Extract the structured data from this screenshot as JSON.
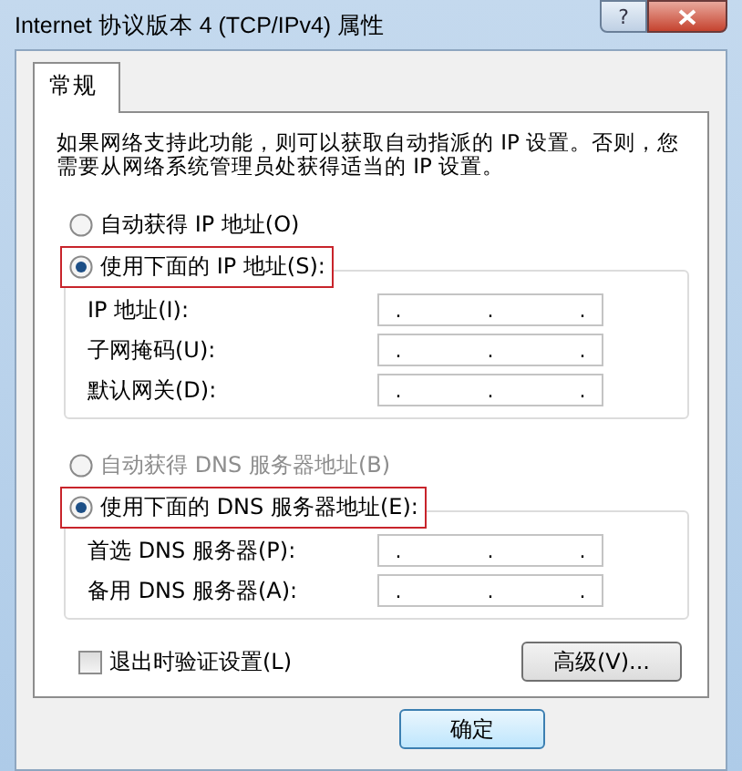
{
  "window": {
    "title": "Internet 协议版本 4 (TCP/IPv4) 属性",
    "help": "?"
  },
  "tabs": [
    {
      "label": "常规",
      "selected": true
    }
  ],
  "description": "如果网络支持此功能，则可以获取自动指派的 IP 设置。否则，您需要从网络系统管理员处获得适当的 IP 设置。",
  "ip_options": [
    {
      "label": "自动获得 IP 地址(O)",
      "selected": false,
      "disabled": false,
      "highlighted": false
    },
    {
      "label": "使用下面的 IP 地址(S):",
      "selected": true,
      "disabled": false,
      "highlighted": true
    }
  ],
  "ip_fields": [
    {
      "label": "IP 地址(I):",
      "value": ".  .  ."
    },
    {
      "label": "子网掩码(U):",
      "value": ".  .  ."
    },
    {
      "label": "默认网关(D):",
      "value": ".  .  ."
    }
  ],
  "dns_options": [
    {
      "label": "自动获得 DNS 服务器地址(B)",
      "selected": false,
      "disabled": true,
      "highlighted": false
    },
    {
      "label": "使用下面的 DNS 服务器地址(E):",
      "selected": true,
      "disabled": false,
      "highlighted": true
    }
  ],
  "dns_fields": [
    {
      "label": "首选 DNS 服务器(P):",
      "value": ".  .  ."
    },
    {
      "label": "备用 DNS 服务器(A):",
      "value": ".  .  ."
    }
  ],
  "validate_checkbox": {
    "label": "退出时验证设置(L)",
    "checked": false
  },
  "advanced_button": "高级(V)...",
  "ok_button": "确定"
}
